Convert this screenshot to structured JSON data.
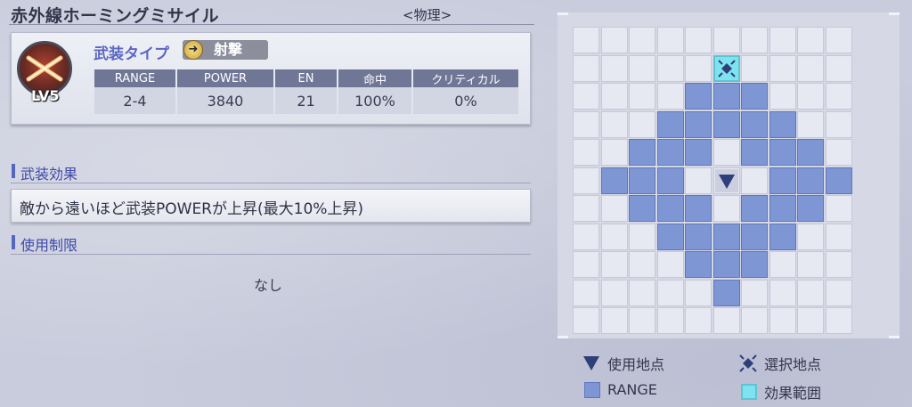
{
  "weapon": {
    "name": "赤外線ホーミングミサイル",
    "category": "<物理>",
    "level": "LV5",
    "type_label": "武装タイプ",
    "type_value": "射撃",
    "type_icon": "arrow-right-icon"
  },
  "stats": {
    "headers": [
      "RANGE",
      "POWER",
      "EN",
      "命中",
      "クリティカル"
    ],
    "values": [
      "2-4",
      "3840",
      "21",
      "100%",
      "0%"
    ]
  },
  "effect": {
    "title": "武装効果",
    "text": "敵から遠いほど武装POWERが上昇(最大10%上昇)"
  },
  "restriction": {
    "title": "使用制限",
    "text": "なし"
  },
  "range_map": {
    "rows": 11,
    "cols": 10,
    "use_point": [
      5,
      5
    ],
    "target_point": [
      1,
      5
    ],
    "range_cells": [
      [
        2,
        4
      ],
      [
        2,
        5
      ],
      [
        2,
        6
      ],
      [
        3,
        3
      ],
      [
        3,
        4
      ],
      [
        3,
        5
      ],
      [
        3,
        6
      ],
      [
        3,
        7
      ],
      [
        4,
        2
      ],
      [
        4,
        3
      ],
      [
        4,
        4
      ],
      [
        4,
        6
      ],
      [
        4,
        7
      ],
      [
        4,
        8
      ],
      [
        5,
        1
      ],
      [
        5,
        2
      ],
      [
        5,
        3
      ],
      [
        5,
        7
      ],
      [
        5,
        8
      ],
      [
        5,
        9
      ],
      [
        6,
        2
      ],
      [
        6,
        3
      ],
      [
        6,
        4
      ],
      [
        6,
        6
      ],
      [
        6,
        7
      ],
      [
        6,
        8
      ],
      [
        7,
        3
      ],
      [
        7,
        4
      ],
      [
        7,
        5
      ],
      [
        7,
        6
      ],
      [
        7,
        7
      ],
      [
        8,
        4
      ],
      [
        8,
        5
      ],
      [
        8,
        6
      ],
      [
        9,
        5
      ]
    ]
  },
  "legend": {
    "use_point": "使用地点",
    "select_point": "選択地点",
    "range": "RANGE",
    "effect_area": "効果範囲"
  },
  "colors": {
    "range_fill": "#7e97d4",
    "target_fill": "#7ee3ef",
    "marker": "#2e3f7a",
    "accent": "#5466c4"
  }
}
